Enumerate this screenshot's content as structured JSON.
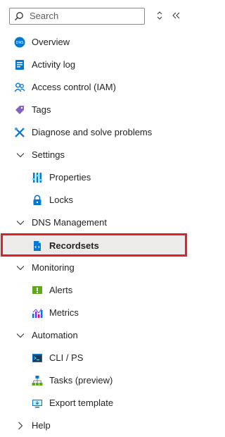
{
  "search": {
    "placeholder": "Search"
  },
  "controls": {
    "updown_icon": "updown-icon",
    "collapse_icon": "double-chevron-left-icon"
  },
  "menu": {
    "overview": "Overview",
    "activity_log": "Activity log",
    "access_control": "Access control (IAM)",
    "tags": "Tags",
    "diagnose": "Diagnose and solve problems",
    "settings": {
      "label": "Settings",
      "items": [
        "Properties",
        "Locks"
      ]
    },
    "dns_management": {
      "label": "DNS Management",
      "items": [
        "Recordsets"
      ]
    },
    "monitoring": {
      "label": "Monitoring",
      "items": [
        "Alerts",
        "Metrics"
      ]
    },
    "automation": {
      "label": "Automation",
      "items": [
        "CLI / PS",
        "Tasks (preview)",
        "Export template"
      ]
    },
    "help": {
      "label": "Help"
    }
  },
  "colors": {
    "highlight_border": "#d9232e",
    "selected_bg": "#edebe9",
    "azure_blue": "#0078d4"
  }
}
